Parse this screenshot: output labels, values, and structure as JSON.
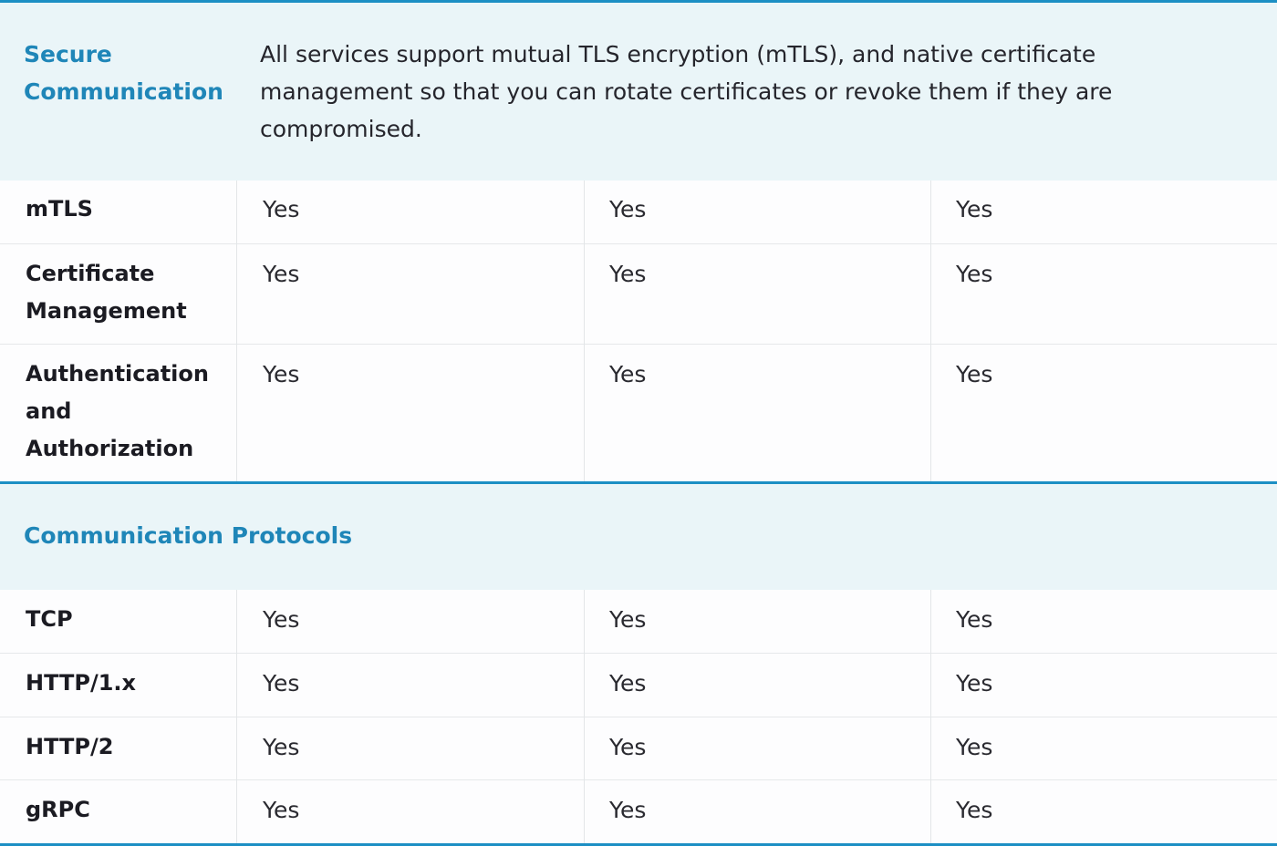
{
  "sections": [
    {
      "title": "Secure Communication",
      "description": "All services support mutual TLS encryption (mTLS), and native certificate management so that you can rotate certificates or revoke them if they are compromised.",
      "rows": [
        {
          "label": "mTLS",
          "values": [
            "Yes",
            "Yes",
            "Yes"
          ]
        },
        {
          "label": "Certificate Management",
          "values": [
            "Yes",
            "Yes",
            "Yes"
          ]
        },
        {
          "label": "Authentication and Authorization",
          "values": [
            "Yes",
            "Yes",
            "Yes"
          ]
        }
      ]
    },
    {
      "title": "Communication Protocols",
      "description": "",
      "rows": [
        {
          "label": "TCP",
          "values": [
            "Yes",
            "Yes",
            "Yes"
          ]
        },
        {
          "label": "HTTP/1.x",
          "values": [
            "Yes",
            "Yes",
            "Yes"
          ]
        },
        {
          "label": "HTTP/2",
          "values": [
            "Yes",
            "Yes",
            "Yes"
          ]
        },
        {
          "label": "gRPC",
          "values": [
            "Yes",
            "Yes",
            "Yes"
          ]
        }
      ]
    }
  ],
  "colors": {
    "accent": "#1c8fc4",
    "section_title": "#1f86b8",
    "section_bg": "#eaf5f8"
  }
}
